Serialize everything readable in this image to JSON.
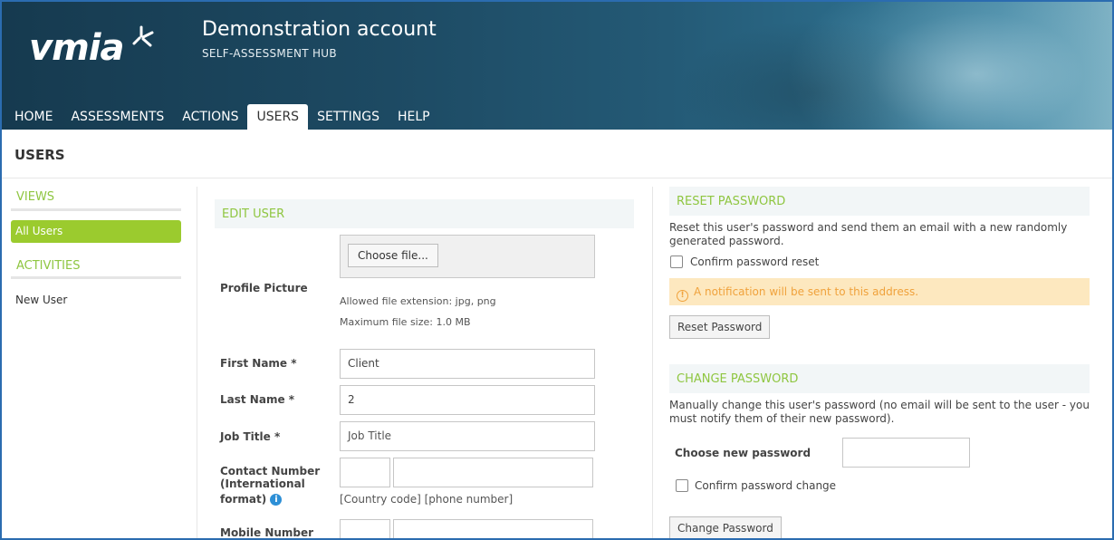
{
  "header": {
    "logo_text": "vmia",
    "account_title": "Demonstration account",
    "account_subtitle": "SELF-ASSESSMENT HUB"
  },
  "nav": {
    "items": [
      {
        "label": "HOME"
      },
      {
        "label": "ASSESSMENTS"
      },
      {
        "label": "ACTIONS"
      },
      {
        "label": "USERS"
      },
      {
        "label": "SETTINGS"
      },
      {
        "label": "HELP"
      }
    ],
    "active": "USERS"
  },
  "page": {
    "title": "USERS"
  },
  "sidebar": {
    "views_heading": "VIEWS",
    "views": [
      {
        "label": "All Users"
      }
    ],
    "activities_heading": "ACTIVITIES",
    "activities": [
      {
        "label": "New User"
      }
    ]
  },
  "edit_user": {
    "heading": "EDIT USER",
    "profile_picture_label": "Profile Picture",
    "choose_file_label": "Choose file...",
    "allowed_ext": "Allowed file extension: jpg, png",
    "max_size": "Maximum file size: 1.0 MB",
    "first_name_label": "First Name *",
    "first_name_value": "Client",
    "last_name_label": "Last Name *",
    "last_name_value": "2",
    "job_title_label": "Job Title *",
    "job_title_placeholder": "Job Title",
    "contact_label_1": "Contact Number",
    "contact_label_2": "(International",
    "contact_label_3": "format)",
    "contact_hint": "[Country code] [phone number]",
    "mobile_label": "Mobile Number"
  },
  "reset_password": {
    "heading": "RESET PASSWORD",
    "description_1": "Reset this user's password and send them an email with a new randomly",
    "description_2": "generated password.",
    "confirm_label": "Confirm password reset",
    "notice": "A notification will be sent to this address.",
    "button_label": "Reset Password"
  },
  "change_password": {
    "heading": "CHANGE PASSWORD",
    "description_1": "Manually change this user's password (no email will be sent to the user - you",
    "description_2": "must notify them of their new password).",
    "new_password_label": "Choose new password",
    "confirm_label": "Confirm password change",
    "button_label": "Change Password"
  },
  "colors": {
    "accent_green": "#9bcb2e",
    "section_heading": "#8fc641",
    "notice_bg": "#fde8bf",
    "notice_text": "#f0a23c",
    "header_dark": "#163a4f"
  },
  "icons": {
    "logo_mark": "vmia-logo-mark",
    "info": "info-icon",
    "notice": "exclamation-circle-icon"
  }
}
